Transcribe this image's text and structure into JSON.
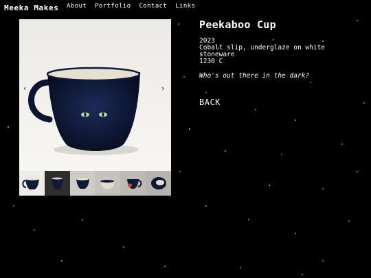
{
  "site": {
    "brand": "Meeka Makes"
  },
  "nav": {
    "items": [
      "About",
      "Portfolio",
      "Contact",
      "Links"
    ]
  },
  "gallery": {
    "prev_glyph": "‹",
    "next_glyph": "›",
    "thumbnail_count": 6,
    "selected_index": 0
  },
  "product": {
    "title": "Peekaboo Cup",
    "year": "2023",
    "materials_line1": "Cobalt slip, underglaze on white",
    "materials_line2": "stoneware",
    "price": "1230 C",
    "quote": "Who's out there in the dark?",
    "back_label": "BACK"
  },
  "colors": {
    "background": "#000000",
    "text": "#ffffff",
    "cup_blue": "#0e1a3a",
    "cup_interior": "#e7dfcf"
  }
}
